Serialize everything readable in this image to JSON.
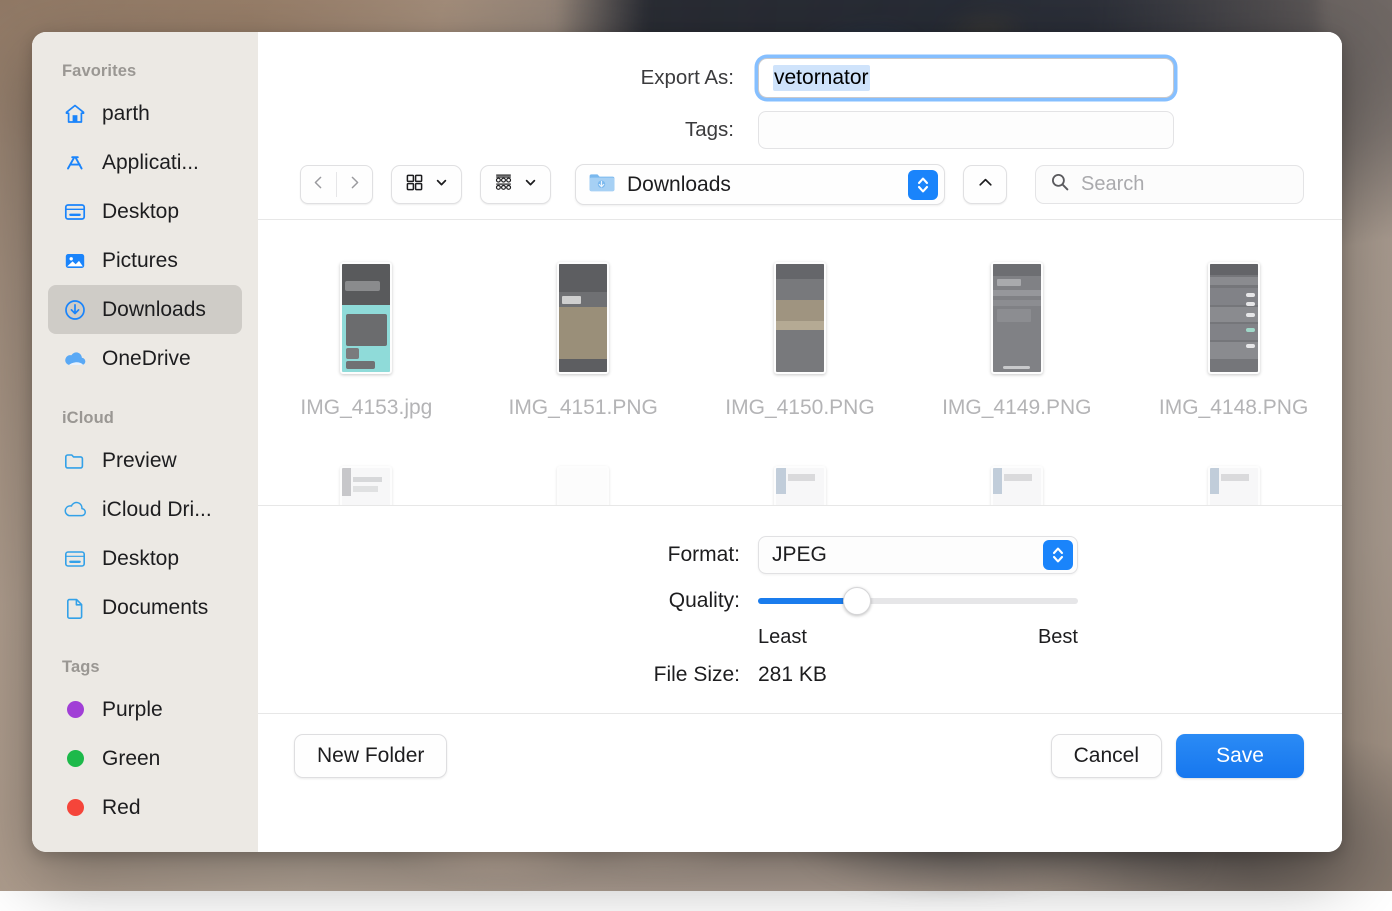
{
  "sidebar": {
    "sections": [
      {
        "title": "Favorites",
        "items": [
          {
            "label": "parth",
            "icon": "home-icon",
            "selected": false
          },
          {
            "label": "Applicati...",
            "icon": "applications-icon",
            "selected": false
          },
          {
            "label": "Desktop",
            "icon": "desktop-icon",
            "selected": false
          },
          {
            "label": "Pictures",
            "icon": "pictures-icon",
            "selected": false
          },
          {
            "label": "Downloads",
            "icon": "downloads-icon",
            "selected": true
          },
          {
            "label": "OneDrive",
            "icon": "cloud-icon",
            "selected": false
          }
        ]
      },
      {
        "title": "iCloud",
        "items": [
          {
            "label": "Preview",
            "icon": "folder-icon",
            "selected": false
          },
          {
            "label": "iCloud Dri...",
            "icon": "cloud-outline-icon",
            "selected": false
          },
          {
            "label": "Desktop",
            "icon": "desktop-icon",
            "selected": false
          },
          {
            "label": "Documents",
            "icon": "document-icon",
            "selected": false
          }
        ]
      },
      {
        "title": "Tags",
        "items": [
          {
            "label": "Purple",
            "icon": "tag-dot-icon",
            "color": "#a13fd6",
            "selected": false
          },
          {
            "label": "Green",
            "icon": "tag-dot-icon",
            "color": "#1db94a",
            "selected": false
          },
          {
            "label": "Red",
            "icon": "tag-dot-icon",
            "color": "#f5453a",
            "selected": false
          }
        ]
      }
    ]
  },
  "form": {
    "name_label": "Export As:",
    "name_value": "vetornator",
    "tags_label": "Tags:",
    "tags_value": "",
    "tags_placeholder": ""
  },
  "toolbar": {
    "back_icon": "chevron-left-icon",
    "forward_icon": "chevron-right-icon",
    "icon_view_icon": "grid-view-icon",
    "icon_view_chevron": "chevron-down-icon",
    "group_view_icon": "gallery-view-icon",
    "group_view_chevron": "chevron-down-icon",
    "path_label": "Downloads",
    "path_folder_icon": "downloads-folder-icon",
    "path_stepper_icon": "updown-stepper-icon",
    "up_icon": "chevron-up-icon",
    "search_icon": "search-icon",
    "search_placeholder": "Search",
    "search_value": ""
  },
  "files": {
    "row1": [
      {
        "name": "IMG_4153.jpg",
        "kind": "image-thumbnail"
      },
      {
        "name": "IMG_4151.PNG",
        "kind": "image-thumbnail"
      },
      {
        "name": "IMG_4150.PNG",
        "kind": "image-thumbnail"
      },
      {
        "name": "IMG_4149.PNG",
        "kind": "image-thumbnail"
      },
      {
        "name": "IMG_4148.PNG",
        "kind": "image-thumbnail"
      }
    ],
    "row2_partial": [
      {
        "name": "",
        "kind": "image-thumbnail"
      },
      {
        "name": "",
        "kind": "image-thumbnail"
      },
      {
        "name": "",
        "kind": "image-thumbnail"
      },
      {
        "name": "",
        "kind": "image-thumbnail"
      },
      {
        "name": "",
        "kind": "image-thumbnail"
      }
    ]
  },
  "options": {
    "format_label": "Format:",
    "format_value": "JPEG",
    "format_stepper_icon": "updown-stepper-icon",
    "quality_label": "Quality:",
    "quality_min_label": "Least",
    "quality_max_label": "Best",
    "quality_percent": 31,
    "filesize_label": "File Size:",
    "filesize_value": "281 KB"
  },
  "footer": {
    "new_folder_label": "New Folder",
    "cancel_label": "Cancel",
    "save_label": "Save"
  },
  "colors": {
    "accent": "#1a7ced",
    "selection": "#cfe3fb",
    "sidebar_bg": "#ece9e4",
    "sidebar_selected": "#cfccc7"
  }
}
